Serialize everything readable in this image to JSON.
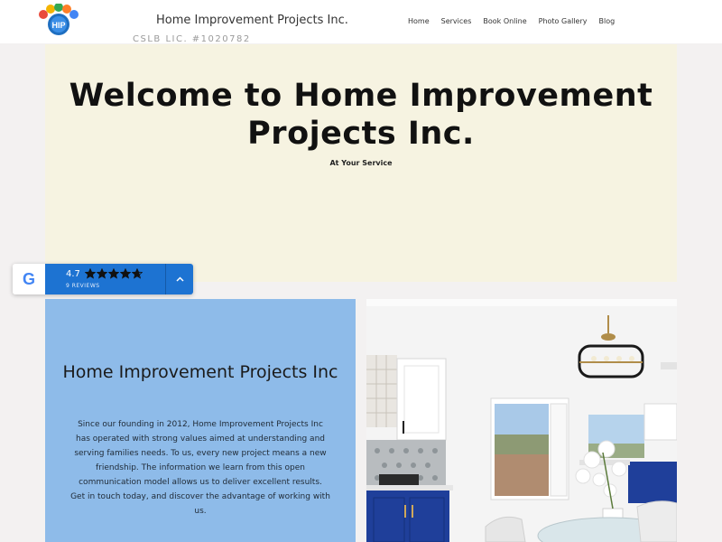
{
  "header": {
    "brand": "Home Improvement Projects Inc.",
    "license": "CSLB LIC. #1020782",
    "logo_alt": "HIP logo",
    "nav": [
      {
        "label": "Home"
      },
      {
        "label": "Services"
      },
      {
        "label": "Book Online"
      },
      {
        "label": "Photo Gallery"
      },
      {
        "label": "Blog"
      }
    ]
  },
  "hero": {
    "title": "Welcome to Home Improvement Projects Inc.",
    "subtitle": "At Your Service"
  },
  "reviews": {
    "score": "4.7",
    "rating": 4.7,
    "count": "9 REVIEWS",
    "icons": {
      "google": "google-g-icon",
      "toggle": "chevron-up-icon"
    }
  },
  "about": {
    "title": "Home Improvement Projects Inc",
    "body": "Since our founding in 2012, Home Improvement Projects Inc has operated with strong values aimed at understanding and serving families needs. To us, every new project means a new friendship. The information we learn from this open communication model allows us to deliver excellent results. Get in touch today, and discover the advantage of working with us."
  },
  "colors": {
    "hero_bg": "#f6f3e1",
    "about_bg": "#8ebbe9",
    "widget_blue": "#1d73d2",
    "page_bg": "#f3f1f1"
  }
}
